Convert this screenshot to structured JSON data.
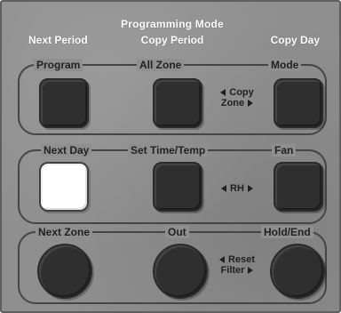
{
  "header": {
    "title": "Programming Mode",
    "left": "Next Period",
    "center": "Copy Period",
    "right": "Copy Day"
  },
  "rows": [
    {
      "labels": [
        "Program",
        "All Zone",
        "Mode"
      ],
      "middle_text_lines": [
        "Copy",
        "Zone"
      ]
    },
    {
      "labels": [
        "Next Day",
        "Set Time/Temp",
        "Fan"
      ],
      "middle_text_lines": [
        "RH"
      ]
    },
    {
      "labels": [
        "Next Zone",
        "Out",
        "Hold/End"
      ],
      "middle_text_lines": [
        "Reset",
        "Filter"
      ]
    }
  ],
  "colors": {
    "panel": "#8f8f8f",
    "text_light": "#ffffff",
    "text_dark": "#1f1f1f",
    "button_dark": "#2f2f2f",
    "button_light": "#ffffff"
  }
}
